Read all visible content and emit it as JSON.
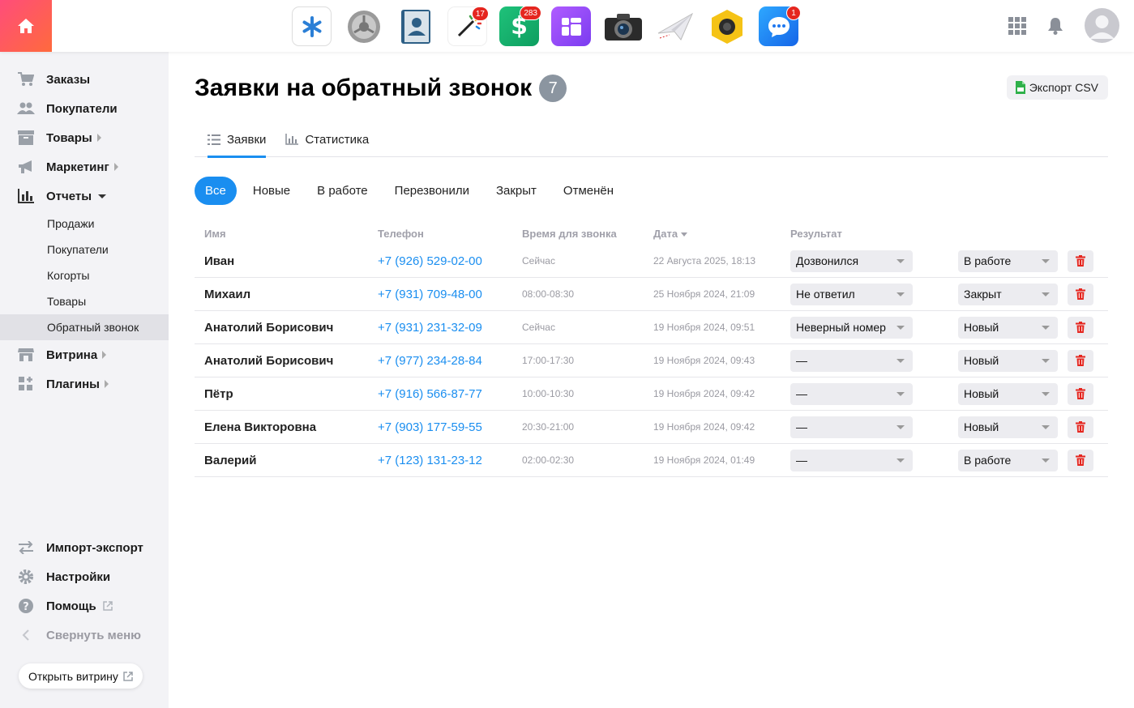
{
  "topbar": {
    "home_icon": "home-icon",
    "apps": [
      {
        "name": "snowflake-app-icon",
        "badge": ""
      },
      {
        "name": "settings-gear-app-icon",
        "badge": ""
      },
      {
        "name": "contacts-book-app-icon",
        "badge": ""
      },
      {
        "name": "magic-wand-app-icon",
        "badge": "17"
      },
      {
        "name": "dollar-app-icon",
        "badge": "283"
      },
      {
        "name": "purple-widgets-app-icon",
        "badge": ""
      },
      {
        "name": "camera-app-icon",
        "badge": ""
      },
      {
        "name": "paper-plane-app-icon",
        "badge": ""
      },
      {
        "name": "webcam-app-icon",
        "badge": ""
      },
      {
        "name": "chat-app-icon",
        "badge": "1"
      }
    ],
    "grid_icon": "apps-grid-icon",
    "bell_icon": "bell-icon",
    "avatar_icon": "user-avatar-icon"
  },
  "sidebar": {
    "items": [
      {
        "label": "Заказы",
        "icon": "cart-icon"
      },
      {
        "label": "Покупатели",
        "icon": "users-icon"
      },
      {
        "label": "Товары",
        "icon": "box-icon"
      },
      {
        "label": "Маркетинг",
        "icon": "megaphone-icon"
      },
      {
        "label": "Отчеты",
        "icon": "bar-chart-icon"
      }
    ],
    "reports_sub": [
      "Продажи",
      "Покупатели",
      "Когорты",
      "Товары",
      "Обратный звонок"
    ],
    "items_after": [
      {
        "label": "Витрина",
        "icon": "storefront-icon"
      },
      {
        "label": "Плагины",
        "icon": "plugins-icon"
      }
    ],
    "bottom": [
      {
        "label": "Импорт-экспорт",
        "icon": "swap-arrows-icon"
      },
      {
        "label": "Настройки",
        "icon": "cog-icon"
      },
      {
        "label": "Помощь",
        "icon": "help-icon"
      },
      {
        "label": "Свернуть меню",
        "icon": "collapse-chevron-icon"
      }
    ],
    "open_store_label": "Открыть витрину"
  },
  "main": {
    "title": "Заявки на обратный звонок",
    "count": "7",
    "export_label": "Экспорт CSV",
    "tabs": [
      {
        "label": "Заявки",
        "icon": "list-icon"
      },
      {
        "label": "Статистика",
        "icon": "stats-icon"
      }
    ],
    "filters": [
      "Все",
      "Новые",
      "В работе",
      "Перезвонили",
      "Закрыт",
      "Отменён"
    ],
    "columns": {
      "name": "Имя",
      "phone": "Телефон",
      "time": "Время для звонка",
      "date": "Дата",
      "result": "Результат"
    },
    "rows": [
      {
        "name": "Иван",
        "phone": "+7 (926) 529-02-00",
        "time": "Сейчас",
        "date": "22 Августа 2025, 18:13",
        "result": "Дозвонился",
        "status": "В работе"
      },
      {
        "name": "Михаил",
        "phone": "+7 (931) 709-48-00",
        "time": "08:00-08:30",
        "date": "25 Ноября 2024, 21:09",
        "result": "Не ответил",
        "status": "Закрыт"
      },
      {
        "name": "Анатолий Борисович",
        "phone": "+7 (931) 231-32-09",
        "time": "Сейчас",
        "date": "19 Ноября 2024, 09:51",
        "result": "Неверный номер",
        "status": "Новый"
      },
      {
        "name": "Анатолий Борисович",
        "phone": "+7 (977) 234-28-84",
        "time": "17:00-17:30",
        "date": "19 Ноября 2024, 09:43",
        "result": "—",
        "status": "Новый"
      },
      {
        "name": "Пётр",
        "phone": "+7 (916) 566-87-77",
        "time": "10:00-10:30",
        "date": "19 Ноября 2024, 09:42",
        "result": "—",
        "status": "Новый"
      },
      {
        "name": "Елена Викторовна",
        "phone": "+7 (903) 177-59-55",
        "time": "20:30-21:00",
        "date": "19 Ноября 2024, 09:42",
        "result": "—",
        "status": "Новый"
      },
      {
        "name": "Валерий",
        "phone": "+7 (123) 131-23-12",
        "time": "02:00-02:30",
        "date": "19 Ноября 2024, 01:49",
        "result": "—",
        "status": "В работе"
      }
    ]
  },
  "colors": {
    "accent": "#1a8ef0",
    "brand_gradient_start": "#ff4d7a",
    "brand_gradient_end": "#ff6a3d",
    "delete": "#e5261f",
    "badge_gray": "#8b95a0"
  }
}
